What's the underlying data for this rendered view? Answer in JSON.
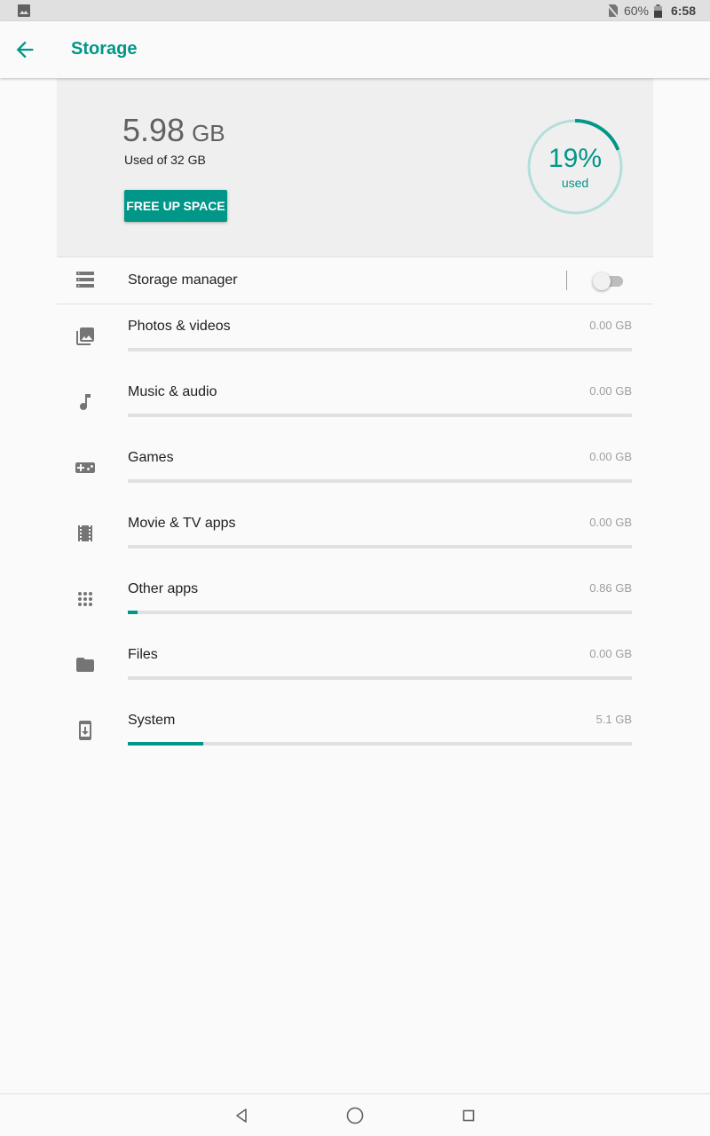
{
  "status_bar": {
    "battery": "60%",
    "time": "6:58",
    "icons": [
      "gallery-notification-icon",
      "no-sim-icon",
      "battery-icon"
    ]
  },
  "app_bar": {
    "title": "Storage",
    "back_icon": "arrow-back-icon"
  },
  "summary": {
    "used_value": "5.98",
    "used_unit": "GB",
    "used_label": "Used of 32 GB",
    "free_button": "FREE UP SPACE",
    "percent_text": "19%",
    "percent_sub": "used",
    "percent_used": 0.19
  },
  "storage_manager": {
    "label": "Storage manager",
    "enabled": false,
    "icon": "storage-manager-icon"
  },
  "categories": [
    {
      "label": "Photos & videos",
      "size": "0.00 GB",
      "fraction": 0.0,
      "icon": "photos-icon"
    },
    {
      "label": "Music & audio",
      "size": "0.00 GB",
      "fraction": 0.0,
      "icon": "music-note-icon"
    },
    {
      "label": "Games",
      "size": "0.00 GB",
      "fraction": 0.0,
      "icon": "gamepad-icon"
    },
    {
      "label": "Movie & TV apps",
      "size": "0.00 GB",
      "fraction": 0.0,
      "icon": "film-icon"
    },
    {
      "label": "Other apps",
      "size": "0.86 GB",
      "fraction": 0.02,
      "icon": "apps-grid-icon"
    },
    {
      "label": "Files",
      "size": "0.00 GB",
      "fraction": 0.0,
      "icon": "folder-icon"
    },
    {
      "label": "System",
      "size": "5.1 GB",
      "fraction": 0.15,
      "icon": "system-update-icon"
    }
  ],
  "colors": {
    "accent": "#009688",
    "ring_track": "#b2dfdb",
    "bar_track": "#e0e0e0",
    "icon": "#757575"
  },
  "nav_bar": {
    "icons": [
      "nav-back-icon",
      "nav-home-icon",
      "nav-recents-icon"
    ]
  }
}
